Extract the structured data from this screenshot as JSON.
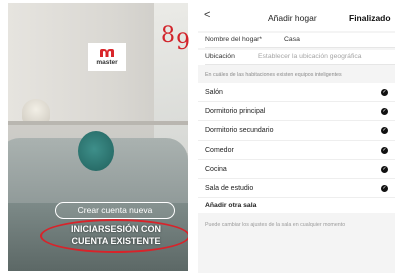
{
  "left_screen": {
    "logo_text": "master",
    "step_number": "8",
    "create_account_label": "Crear cuenta nueva",
    "login_label": "INICIARSESIÓN CON CUENTA EXISTENTE",
    "highlight_color": "#d8232a"
  },
  "right_screen": {
    "step_number": "9",
    "header": {
      "back_icon": "chevron-left-icon",
      "title": "Añadir hogar",
      "done_label": "Finalizado"
    },
    "fields": [
      {
        "label": "Nombre del hogar*",
        "value": "Casa"
      },
      {
        "label": "Ubicación",
        "placeholder": "Establecer la ubicación geográfica"
      }
    ],
    "rooms_hint": "En cuáles de las habitaciones existen equipos inteligentes",
    "rooms": [
      {
        "label": "Salón",
        "checked": true
      },
      {
        "label": "Dormitorio principal",
        "checked": true
      },
      {
        "label": "Dormitorio secundario",
        "checked": true
      },
      {
        "label": "Comedor",
        "checked": true
      },
      {
        "label": "Cocina",
        "checked": true
      },
      {
        "label": "Sala de estudio",
        "checked": true
      }
    ],
    "add_room_label": "Añadir otra sala",
    "footer_hint": "Puede cambiar los ajustes de la sala en cualquier momento"
  }
}
